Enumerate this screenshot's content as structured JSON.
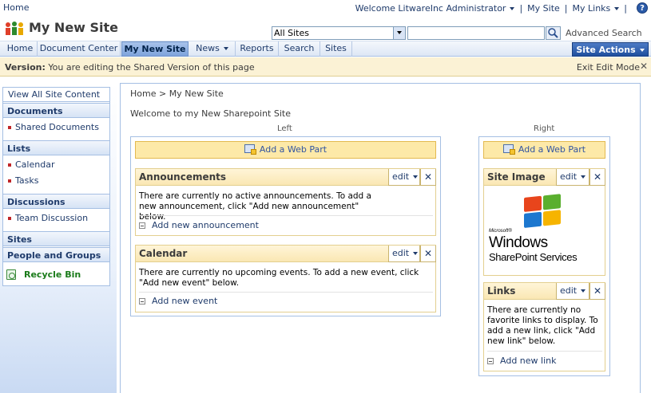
{
  "global": {
    "home": "Home",
    "welcome": "Welcome LitwareInc Administrator",
    "my_site": "My Site",
    "my_links": "My Links",
    "help": "?"
  },
  "header": {
    "site_title": "My New Site",
    "scope_value": "All Sites",
    "search_value": "",
    "advanced_search": "Advanced Search"
  },
  "nav": {
    "tabs": [
      {
        "label": "Home"
      },
      {
        "label": "Document Center"
      },
      {
        "label": "My New Site"
      },
      {
        "label": "News"
      },
      {
        "label": "Reports"
      },
      {
        "label": "Search"
      },
      {
        "label": "Sites"
      }
    ],
    "site_actions": "Site Actions"
  },
  "version_bar": {
    "label": "Version:",
    "text": "You are editing the Shared Version of this page",
    "exit_edit": "Exit Edit Mode",
    "close": "✕"
  },
  "leftnav": {
    "view_all": "View All Site Content",
    "documents": "Documents",
    "shared_documents": "Shared Documents",
    "lists": "Lists",
    "calendar": "Calendar",
    "tasks": "Tasks",
    "discussions": "Discussions",
    "team_discussion": "Team Discussion",
    "sites": "Sites",
    "people_groups": "People and Groups",
    "recycle_bin": "Recycle Bin"
  },
  "main": {
    "breadcrumb": "Home > My New Site",
    "heading": "Welcome to my New Sharepoint Site",
    "left_zone_label": "Left",
    "right_zone_label": "Right",
    "add_web_part": "Add a Web Part"
  },
  "webparts": {
    "announcements": {
      "title": "Announcements",
      "edit": "edit",
      "body": "There are currently no active announcements. To add a new announcement, click \"Add new announcement\" below.",
      "add": "Add new announcement"
    },
    "calendar": {
      "title": "Calendar",
      "edit": "edit",
      "body": "There are currently no upcoming events. To add a new event, click \"Add new event\" below.",
      "add": "Add new event"
    },
    "site_image": {
      "title": "Site Image",
      "edit": "edit",
      "logo_microsoft": "Microsoft®",
      "logo_windows": "Windows",
      "logo_sps": "SharePoint Services"
    },
    "links": {
      "title": "Links",
      "edit": "edit",
      "body": "There are currently no favorite links to display. To add a new link, click \"Add new link\" below.",
      "add": "Add new link"
    }
  }
}
